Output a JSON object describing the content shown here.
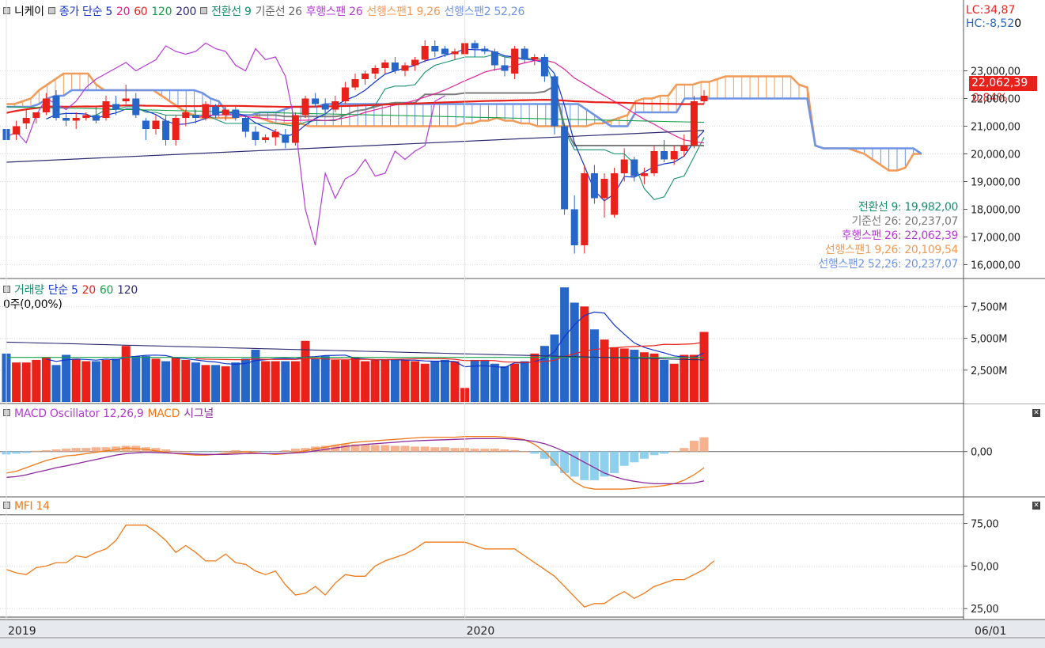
{
  "colors": {
    "up": "#e8221b",
    "down": "#2666c9",
    "tenkan": "#14906c",
    "kijun": "#7c7c7c",
    "chikou": "#b63ad6",
    "spanA": "#f29a57",
    "spanB": "#6f94e3",
    "ma5": "#1133cc",
    "ma20": "#e0229a",
    "ma60": "#17a04a",
    "ma120": "#888888",
    "ma200": "#2b2b70",
    "macd": "#f07818",
    "signal": "#8b2a9b",
    "osc_pos": "#f5b28e",
    "osc_neg": "#8fd0ee",
    "mfi": "#f07818"
  },
  "price_pane": {
    "legend": {
      "symbol": "니케이",
      "price": "종가 단순 5",
      "ma20": "20",
      "ma60": "60",
      "ma120": "120",
      "ma200": "200",
      "tenkan": "전환선 9",
      "kijun": "기준선 26",
      "chikou": "후행스팬 26",
      "spanA": "선행스팬1 9,26",
      "spanB": "선행스팬2 52,26"
    },
    "lc": "LC:34,87",
    "hc": "HC:-8,52",
    "hc_suffix": "0",
    "last_price": "22,062,39",
    "change": "0,84%",
    "y_ticks": [
      {
        "v": 23000,
        "label": "23,000,00"
      },
      {
        "v": 22000,
        "label": "22,000,00"
      },
      {
        "v": 21000,
        "label": "21,000,00"
      },
      {
        "v": 20000,
        "label": "20,000,00"
      },
      {
        "v": 19000,
        "label": "19,000,00"
      },
      {
        "v": 18000,
        "label": "18,000,00"
      },
      {
        "v": 17000,
        "label": "17,000,00"
      },
      {
        "v": 16000,
        "label": "16,000,00"
      }
    ],
    "ylim": [
      15700,
      24700
    ],
    "values": [
      {
        "label": "전환선 9: 19,982,00",
        "key": "tenkan"
      },
      {
        "label": "기준선 26: 20,237,07",
        "key": "kijun"
      },
      {
        "label": "후행스팬 26: 22,062,39",
        "key": "chikou"
      },
      {
        "label": "선행스팬1 9,26: 20,109,54",
        "key": "spanA"
      },
      {
        "label": "선행스팬2 52,26: 20,237,07",
        "key": "spanB"
      }
    ]
  },
  "volume_pane": {
    "legend": {
      "name": "거래량",
      "simple": "단순 5",
      "ma20": "20",
      "ma60": "60",
      "ma120": "120"
    },
    "sub": "0주(0,00%)",
    "y_ticks": [
      {
        "v": 7500,
        "label": "7,500M"
      },
      {
        "v": 5000,
        "label": "5,000M"
      },
      {
        "v": 2500,
        "label": "2,500M"
      }
    ],
    "ylim": [
      0,
      9200
    ],
    "cur_value": "0",
    "cur_pct": "0,00%"
  },
  "macd_pane": {
    "legend": {
      "osc": "MACD Oscillator 12,26,9",
      "macd": "MACD",
      "signal": "시그널"
    },
    "y_ticks": [
      {
        "v": 0,
        "label": "0,00"
      }
    ],
    "ylim": [
      -1200,
      900
    ]
  },
  "mfi_pane": {
    "legend": {
      "name": "MFI 14"
    },
    "y_ticks": [
      {
        "v": 75,
        "label": "75,00"
      },
      {
        "v": 50,
        "label": "50,00"
      },
      {
        "v": 25,
        "label": "25,00"
      }
    ],
    "ylim": [
      20,
      85
    ]
  },
  "x_axis": {
    "labels": [
      {
        "i": 0,
        "label": "2019"
      },
      {
        "i": 46,
        "label": "2020"
      }
    ],
    "end": "06/01"
  },
  "chart_data": {
    "type": "candlestick",
    "x_labels": [
      "2019",
      "2020"
    ],
    "candles": [
      [
        20900,
        21000,
        20300,
        20500
      ],
      [
        20700,
        21200,
        20500,
        21000
      ],
      [
        21100,
        21600,
        20900,
        21300
      ],
      [
        21300,
        21500,
        21100,
        21500
      ],
      [
        21500,
        22200,
        21400,
        22000
      ],
      [
        22100,
        22300,
        21200,
        21300
      ],
      [
        21300,
        21500,
        21000,
        21200
      ],
      [
        21200,
        21500,
        20900,
        21300
      ],
      [
        21300,
        21500,
        21200,
        21400
      ],
      [
        21400,
        21700,
        21100,
        21200
      ],
      [
        21300,
        22100,
        21200,
        21900
      ],
      [
        21800,
        22100,
        21400,
        21600
      ],
      [
        21900,
        22500,
        21800,
        22000
      ],
      [
        22000,
        22200,
        21300,
        21400
      ],
      [
        21200,
        21300,
        20500,
        20900
      ],
      [
        20900,
        21400,
        20700,
        21200
      ],
      [
        21200,
        21400,
        20300,
        20500
      ],
      [
        20500,
        21400,
        20300,
        21300
      ],
      [
        21300,
        21600,
        21000,
        21500
      ],
      [
        21400,
        21600,
        21100,
        21300
      ],
      [
        21300,
        21900,
        21200,
        21800
      ],
      [
        21700,
        21800,
        21300,
        21400
      ],
      [
        21400,
        21700,
        21200,
        21600
      ],
      [
        21600,
        21700,
        21200,
        21300
      ],
      [
        21300,
        21400,
        20600,
        20800
      ],
      [
        20800,
        21000,
        20300,
        20500
      ],
      [
        20500,
        20700,
        20400,
        20600
      ],
      [
        20600,
        20900,
        20300,
        20800
      ],
      [
        20700,
        20900,
        20200,
        20400
      ],
      [
        20400,
        21500,
        20300,
        21400
      ],
      [
        21400,
        22100,
        21300,
        22000
      ],
      [
        22000,
        22200,
        21700,
        21800
      ],
      [
        21800,
        22000,
        21400,
        21600
      ],
      [
        21600,
        22100,
        21500,
        21900
      ],
      [
        21900,
        22600,
        21800,
        22400
      ],
      [
        22400,
        22900,
        22300,
        22700
      ],
      [
        22700,
        23000,
        22500,
        22900
      ],
      [
        22900,
        23200,
        22700,
        23100
      ],
      [
        23100,
        23400,
        22900,
        23300
      ],
      [
        23300,
        23500,
        22900,
        23000
      ],
      [
        23000,
        23300,
        22800,
        23200
      ],
      [
        23200,
        23500,
        23000,
        23400
      ],
      [
        23400,
        24100,
        23300,
        23900
      ],
      [
        23900,
        24100,
        23500,
        23700
      ],
      [
        23800,
        23900,
        23500,
        23600
      ],
      [
        23600,
        23800,
        23400,
        23700
      ],
      [
        23600,
        24200,
        23500,
        24000
      ],
      [
        24000,
        24100,
        23500,
        23800
      ],
      [
        23800,
        23900,
        23600,
        23700
      ],
      [
        23700,
        23800,
        23000,
        23200
      ],
      [
        23200,
        23500,
        22800,
        23000
      ],
      [
        22900,
        23900,
        22700,
        23800
      ],
      [
        23800,
        23900,
        23300,
        23400
      ],
      [
        23400,
        23600,
        23200,
        23500
      ],
      [
        23500,
        23600,
        22600,
        22800
      ],
      [
        22800,
        22900,
        20700,
        21000
      ],
      [
        21000,
        21100,
        17800,
        18000
      ],
      [
        18000,
        18500,
        16400,
        16700
      ],
      [
        16700,
        19600,
        16400,
        19300
      ],
      [
        19300,
        19600,
        18200,
        18400
      ],
      [
        18400,
        19300,
        17700,
        19100
      ],
      [
        17800,
        19500,
        17700,
        19300
      ],
      [
        19300,
        20200,
        19000,
        19800
      ],
      [
        19800,
        19900,
        19000,
        19200
      ],
      [
        19200,
        19500,
        18900,
        19300
      ],
      [
        19300,
        20300,
        19200,
        20100
      ],
      [
        20100,
        20500,
        19700,
        19800
      ],
      [
        19800,
        20300,
        19600,
        20100
      ],
      [
        20100,
        20700,
        19900,
        20300
      ],
      [
        20300,
        22100,
        20200,
        21900
      ],
      [
        21900,
        22300,
        21800,
        22100
      ]
    ],
    "ichimoku_cloud": {
      "spanA": [
        21800,
        21800,
        21900,
        22000,
        22300,
        22500,
        22700,
        22900,
        22900,
        22900,
        22900,
        22500,
        22300,
        22300,
        22300,
        22300,
        22300,
        22300,
        22300,
        22100,
        21900,
        21700,
        21500,
        21400,
        21300,
        21300,
        21300,
        21300,
        21300,
        21400,
        21400,
        21300,
        21200,
        21100,
        21100,
        21100,
        21100,
        21000,
        21000,
        21000,
        21000,
        21000,
        21000,
        21000,
        21000,
        21000,
        21000,
        21000,
        21000,
        21000,
        21000,
        21000,
        21000,
        21000,
        21000,
        21000,
        21100,
        21100,
        21200,
        21200,
        21300,
        21200,
        21200,
        21100,
        21100,
        21000,
        21000,
        21000,
        21000,
        21000,
        21000,
        21000,
        21100,
        21100,
        21200,
        21300,
        21400,
        21900,
        22000,
        22000,
        22100,
        22100,
        22500,
        22500,
        22500,
        22600,
        22600,
        22700,
        22800,
        22800,
        22800,
        22800,
        22800,
        22800,
        22800,
        22800,
        22800,
        22500,
        22400,
        20300,
        20200,
        20200,
        20200,
        20200,
        20100,
        20000,
        19800,
        19600,
        19400,
        19400,
        19500,
        20000,
        20000
      ],
      "spanB": [
        21700,
        21700,
        21700,
        21700,
        21800,
        22000,
        22100,
        22100,
        22300,
        22300,
        22300,
        22300,
        22300,
        22300,
        22300,
        22300,
        22300,
        22300,
        22300,
        22300,
        22300,
        22300,
        22300,
        22300,
        22200,
        22000,
        21900,
        21500,
        21400,
        21400,
        21400,
        21500,
        21500,
        21500,
        21600,
        21700,
        21700,
        21700,
        21700,
        21800,
        21800,
        21800,
        21800,
        21800,
        21800,
        21800,
        21800,
        21800,
        21800,
        21800,
        21800,
        21800,
        21800,
        21800,
        21800,
        21800,
        21800,
        21800,
        21800,
        21800,
        21800,
        21800,
        21800,
        21800,
        21800,
        21800,
        21800,
        21800,
        21800,
        21800,
        21800,
        21600,
        21400,
        21200,
        21000,
        21000,
        21000,
        21500,
        21500,
        21500,
        21500,
        21500,
        21500,
        22000,
        22000,
        22000,
        22000,
        22000,
        22000,
        22000,
        22000,
        22000,
        22000,
        22000,
        22000,
        22000,
        22000,
        22000,
        22000,
        20300,
        20200,
        20200,
        20200,
        20200,
        20200,
        20200,
        20200,
        20200,
        20200,
        20200,
        20200,
        20200,
        20000
      ]
    },
    "volume": [
      3800,
      3100,
      3100,
      3300,
      3500,
      2900,
      3700,
      3400,
      3200,
      3200,
      3300,
      3400,
      4400,
      3600,
      3600,
      3400,
      3200,
      3500,
      3300,
      3100,
      2900,
      2900,
      2800,
      3100,
      3400,
      4100,
      3200,
      3200,
      3200,
      3200,
      4800,
      3400,
      3600,
      3300,
      3300,
      3500,
      3200,
      3300,
      3300,
      3300,
      3300,
      3200,
      3000,
      3200,
      3300,
      3200,
      1100,
      3300,
      3300,
      3000,
      2800,
      3000,
      3200,
      3800,
      4400,
      5300,
      9000,
      7800,
      7500,
      5700,
      4900,
      4300,
      4200,
      4100,
      3900,
      3800,
      3300,
      3000,
      3700,
      3700,
      5500
    ],
    "macd_osc": [
      -80,
      -60,
      -40,
      20,
      40,
      60,
      80,
      100,
      100,
      120,
      120,
      140,
      160,
      160,
      120,
      100,
      60,
      20,
      0,
      -20,
      -20,
      -10,
      20,
      40,
      20,
      0,
      -20,
      -10,
      40,
      80,
      100,
      140,
      160,
      180,
      200,
      200,
      200,
      180,
      180,
      160,
      160,
      140,
      140,
      120,
      120,
      100,
      100,
      80,
      80,
      80,
      60,
      40,
      0,
      -60,
      -200,
      -400,
      -600,
      -700,
      -800,
      -800,
      -700,
      -600,
      -400,
      -300,
      -200,
      -100,
      -60,
      0,
      100,
      300,
      400
    ],
    "macd": [
      -600,
      -550,
      -450,
      -350,
      -250,
      -180,
      -120,
      -100,
      -60,
      -20,
      20,
      50,
      100,
      80,
      60,
      20,
      -20,
      -60,
      -80,
      -100,
      -100,
      -80,
      -50,
      -30,
      -10,
      -40,
      -60,
      -80,
      -60,
      -20,
      20,
      80,
      120,
      180,
      220,
      260,
      280,
      300,
      320,
      340,
      360,
      380,
      400,
      400,
      400,
      400,
      420,
      420,
      420,
      420,
      400,
      380,
      330,
      200,
      0,
      -300,
      -600,
      -850,
      -1000,
      -1050,
      -1050,
      -1050,
      -1050,
      -1030,
      -1000,
      -980,
      -950,
      -900,
      -800,
      -650,
      -450
    ],
    "signal": [
      -720,
      -700,
      -650,
      -580,
      -520,
      -450,
      -400,
      -340,
      -280,
      -220,
      -160,
      -100,
      -60,
      -40,
      -20,
      -30,
      -40,
      -50,
      -60,
      -70,
      -80,
      -80,
      -80,
      -70,
      -60,
      -50,
      -60,
      -60,
      -50,
      -40,
      -20,
      20,
      60,
      100,
      140,
      170,
      200,
      220,
      240,
      260,
      280,
      300,
      310,
      320,
      330,
      340,
      350,
      360,
      360,
      360,
      360,
      340,
      320,
      280,
      220,
      120,
      0,
      -150,
      -300,
      -450,
      -600,
      -700,
      -780,
      -830,
      -870,
      -900,
      -900,
      -900,
      -900,
      -880,
      -820
    ],
    "mfi": [
      48,
      46,
      45,
      49,
      50,
      52,
      52,
      56,
      55,
      58,
      60,
      65,
      74,
      74,
      74,
      70,
      65,
      58,
      62,
      58,
      53,
      53,
      57,
      52,
      51,
      47,
      45,
      47,
      39,
      33,
      34,
      38,
      33,
      40,
      45,
      44,
      44,
      50,
      53,
      55,
      57,
      60,
      64,
      64,
      64,
      64,
      64,
      62,
      60,
      60,
      60,
      60,
      56,
      52,
      48,
      44,
      38,
      32,
      26,
      28,
      28,
      32,
      35,
      31,
      34,
      38,
      40,
      42,
      42,
      45,
      48,
      53
    ]
  }
}
